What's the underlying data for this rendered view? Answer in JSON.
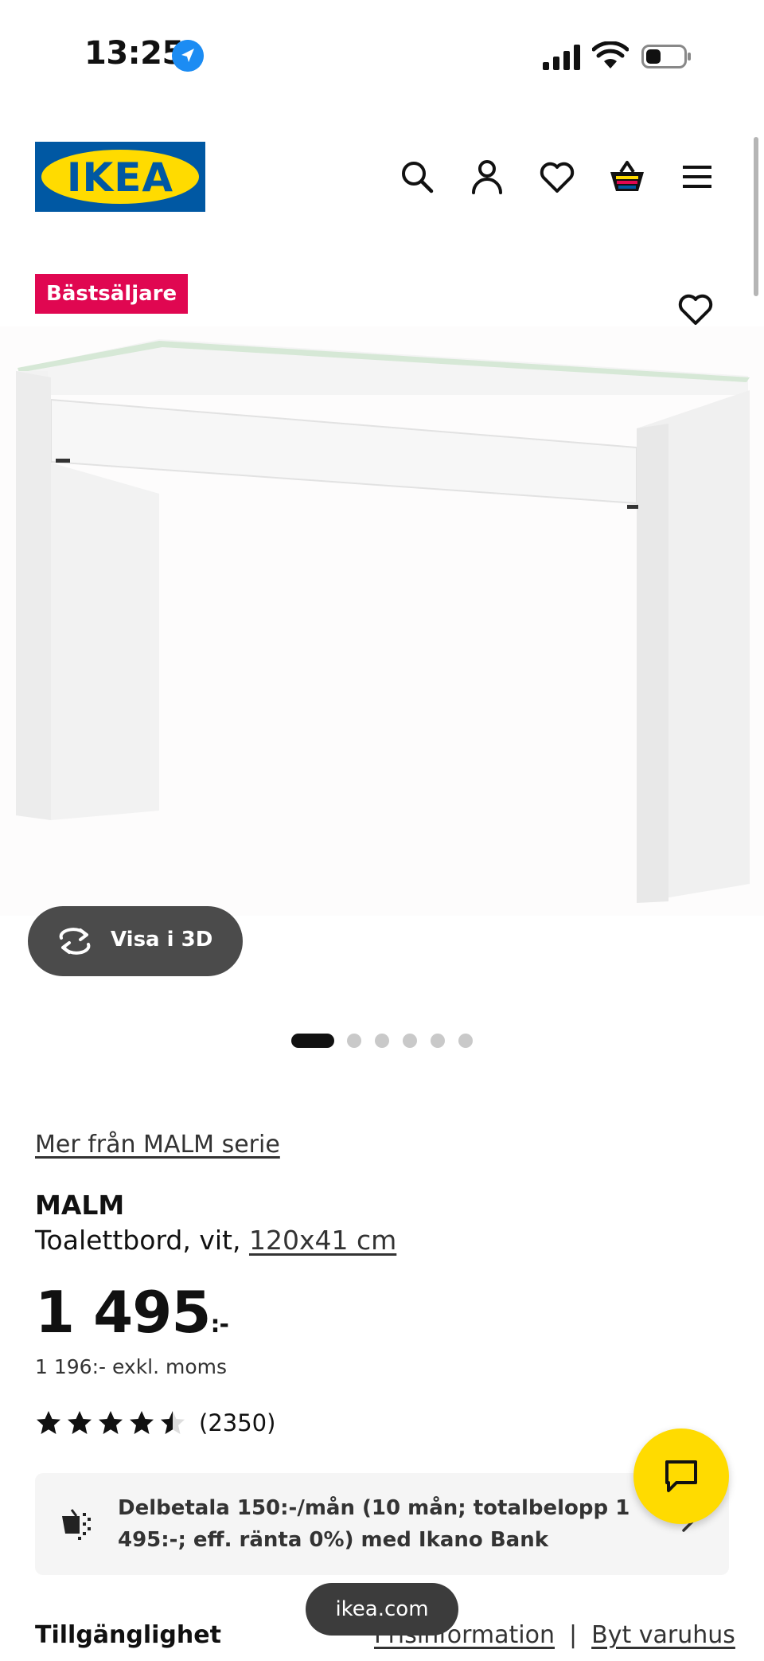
{
  "status_bar": {
    "time": "13:25"
  },
  "header": {
    "logo_text": "IKEA",
    "icons": [
      "search-icon",
      "account-icon",
      "heart-icon",
      "basket-icon",
      "menu-icon"
    ]
  },
  "product_gallery": {
    "badge": "Bästsäljare",
    "view_3d_label": "Visa i 3D",
    "image_count": 6,
    "active_image_index": 0
  },
  "product": {
    "series_link": "Mer från MALM serie",
    "name": "MALM",
    "description_prefix": "Toalettbord, vit, ",
    "size_link": "120x41 cm",
    "price_whole": "1 495",
    "price_suffix": ":-",
    "price_ex_vat": "1 196:- exkl. moms",
    "rating_value": 4.5,
    "rating_max": 5,
    "review_count": "(2350)"
  },
  "payment": {
    "text": "Delbetala 150:-/mån (10 mån; totalbelopp 1 495:-; eff. ränta 0%) med Ikano Bank"
  },
  "availability": {
    "title": "Tillgänglighet",
    "price_info_link": "Prisinformation",
    "separator": "|",
    "change_store_link": "Byt varuhus"
  },
  "browser": {
    "url": "ikea.com"
  },
  "colors": {
    "ikea_blue": "#0058a3",
    "ikea_yellow": "#ffdb00",
    "badge_red": "#e00751",
    "pill_dark": "#4b4b4b"
  }
}
